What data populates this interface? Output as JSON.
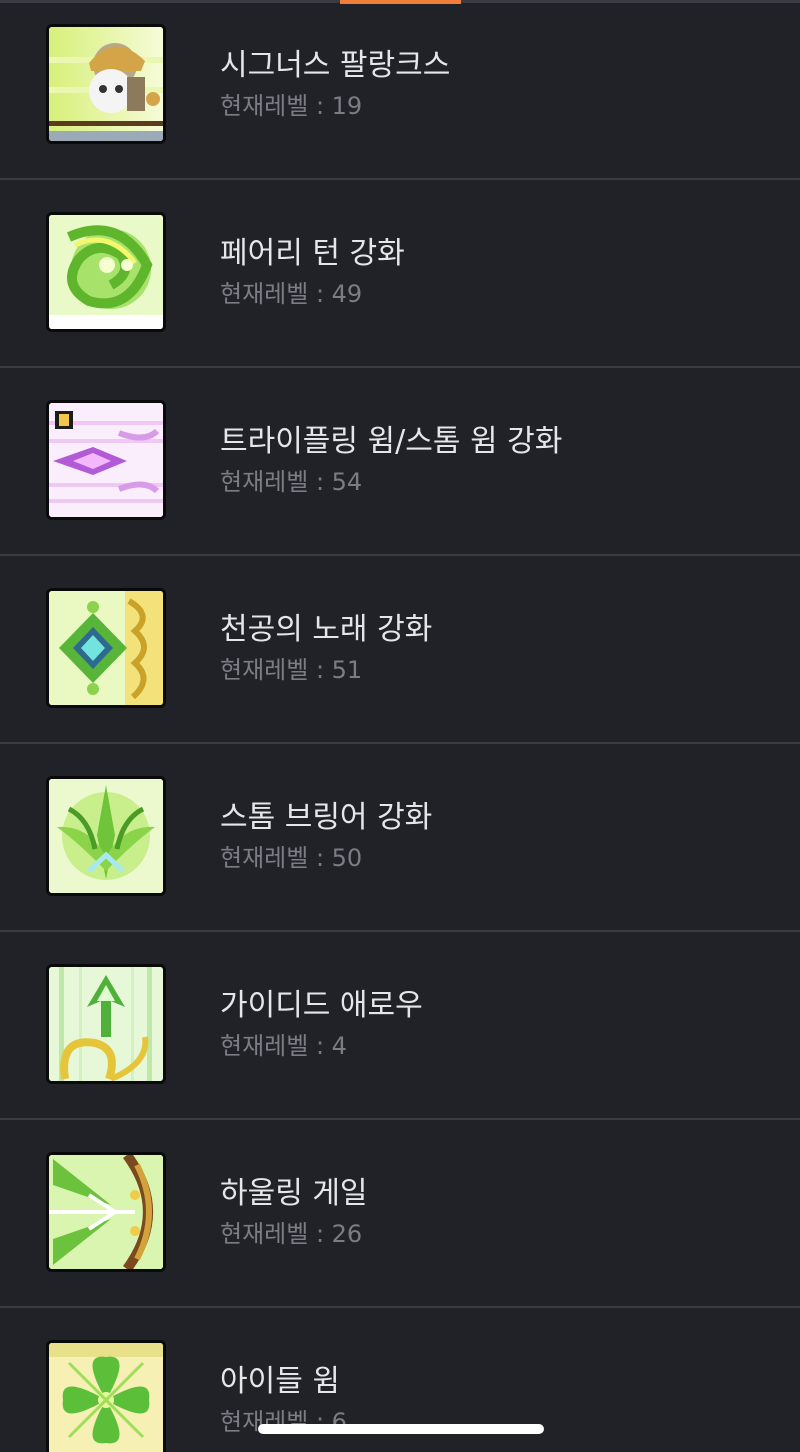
{
  "theme": {
    "accent": "#f07d3a",
    "background": "#212228",
    "divider": "#3a3b44"
  },
  "level_prefix": "현재레벨",
  "skills": [
    {
      "name": "시그너스 팔랑크스",
      "level_text": "현재레벨 : 19",
      "level": 19,
      "icon": "cygnus-phalanx-icon"
    },
    {
      "name": "페어리 턴 강화",
      "level_text": "현재레벨 : 49",
      "level": 49,
      "icon": "fairy-turn-icon"
    },
    {
      "name": "트라이플링 윔/스톰 윔 강화",
      "level_text": "현재레벨 : 54",
      "level": 54,
      "icon": "trifling-whim-icon"
    },
    {
      "name": "천공의 노래 강화",
      "level_text": "현재레벨 : 51",
      "level": 51,
      "icon": "song-of-heaven-icon"
    },
    {
      "name": "스톰 브링어 강화",
      "level_text": "현재레벨 : 50",
      "level": 50,
      "icon": "storm-bringer-icon"
    },
    {
      "name": "가이디드 애로우",
      "level_text": "현재레벨 : 4",
      "level": 4,
      "icon": "guided-arrow-icon"
    },
    {
      "name": "하울링 게일",
      "level_text": "현재레벨 : 26",
      "level": 26,
      "icon": "howling-gale-icon"
    },
    {
      "name": "아이들 윔",
      "level_text": "현재레벨 : 6",
      "level": 6,
      "icon": "idle-whim-icon"
    }
  ]
}
